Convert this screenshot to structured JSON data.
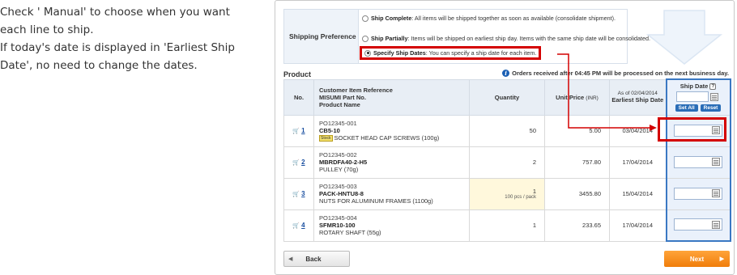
{
  "instructions": {
    "line1": "Check ' Manual' to choose when you want",
    "line2": "each line to ship.",
    "line3": "If today's date is displayed in 'Earliest Ship",
    "line4": "Date', no need to change the dates."
  },
  "shipping": {
    "label": "Shipping Preference",
    "required_mark": "*",
    "options": [
      {
        "title": "Ship Complete",
        "desc": ": All items will be shipped together as soon as available (consolidate shipment).",
        "selected": false
      },
      {
        "title": "Ship Partially",
        "desc": ": Items will be shipped on earliest ship day. Items with the same ship date will be consolidated.",
        "selected": false
      },
      {
        "title": "Specify Ship Dates",
        "desc": ": You can specify a ship date for each item.",
        "selected": true
      }
    ]
  },
  "product": {
    "title": "Product",
    "notice": "Orders received after 04:45 PM will be processed on the next business day.",
    "headers": {
      "no": "No.",
      "ref_line1": "Customer Item Reference",
      "ref_line2": "MISUMI Part No.",
      "ref_line3": "Product Name",
      "qty": "Quantity",
      "price": "Unit Price",
      "currency": "(INR)",
      "as_of": "As of 02/04/2014",
      "earliest": "Earliest Ship Date",
      "ship_date": "Ship Date",
      "help": "?",
      "set_all": "Set All",
      "reset": "Reset"
    },
    "stock_badge": "Stock",
    "rows": [
      {
        "no": "1",
        "ref": "PO12345-001",
        "part": "CB5-10",
        "name": "SOCKET HEAD CAP SCREWS (100g)",
        "qty": "50",
        "qty_note": "",
        "price": "5.00",
        "ship": "03/04/2014"
      },
      {
        "no": "2",
        "ref": "PO12345-002",
        "part": "MBRDFA40-2-H5",
        "name": "PULLEY (70g)",
        "qty": "2",
        "qty_note": "",
        "price": "757.80",
        "ship": "17/04/2014"
      },
      {
        "no": "3",
        "ref": "PO12345-003",
        "part": "PACK-HNTU8-8",
        "name": "NUTS FOR ALUMINUM FRAMES (1100g)",
        "qty": "1",
        "qty_note": "100 pcs / pack",
        "price": "3455.80",
        "ship": "15/04/2014"
      },
      {
        "no": "4",
        "ref": "PO12345-004",
        "part": "SFMR10-100",
        "name": "ROTARY SHAFT (55g)",
        "qty": "1",
        "qty_note": "",
        "price": "233.65",
        "ship": "17/04/2014"
      }
    ]
  },
  "buttons": {
    "back": "Back",
    "next": "Next"
  },
  "colors": {
    "highlight": "#d40000",
    "accent": "#2a6db7",
    "next": "#f07d0a"
  }
}
